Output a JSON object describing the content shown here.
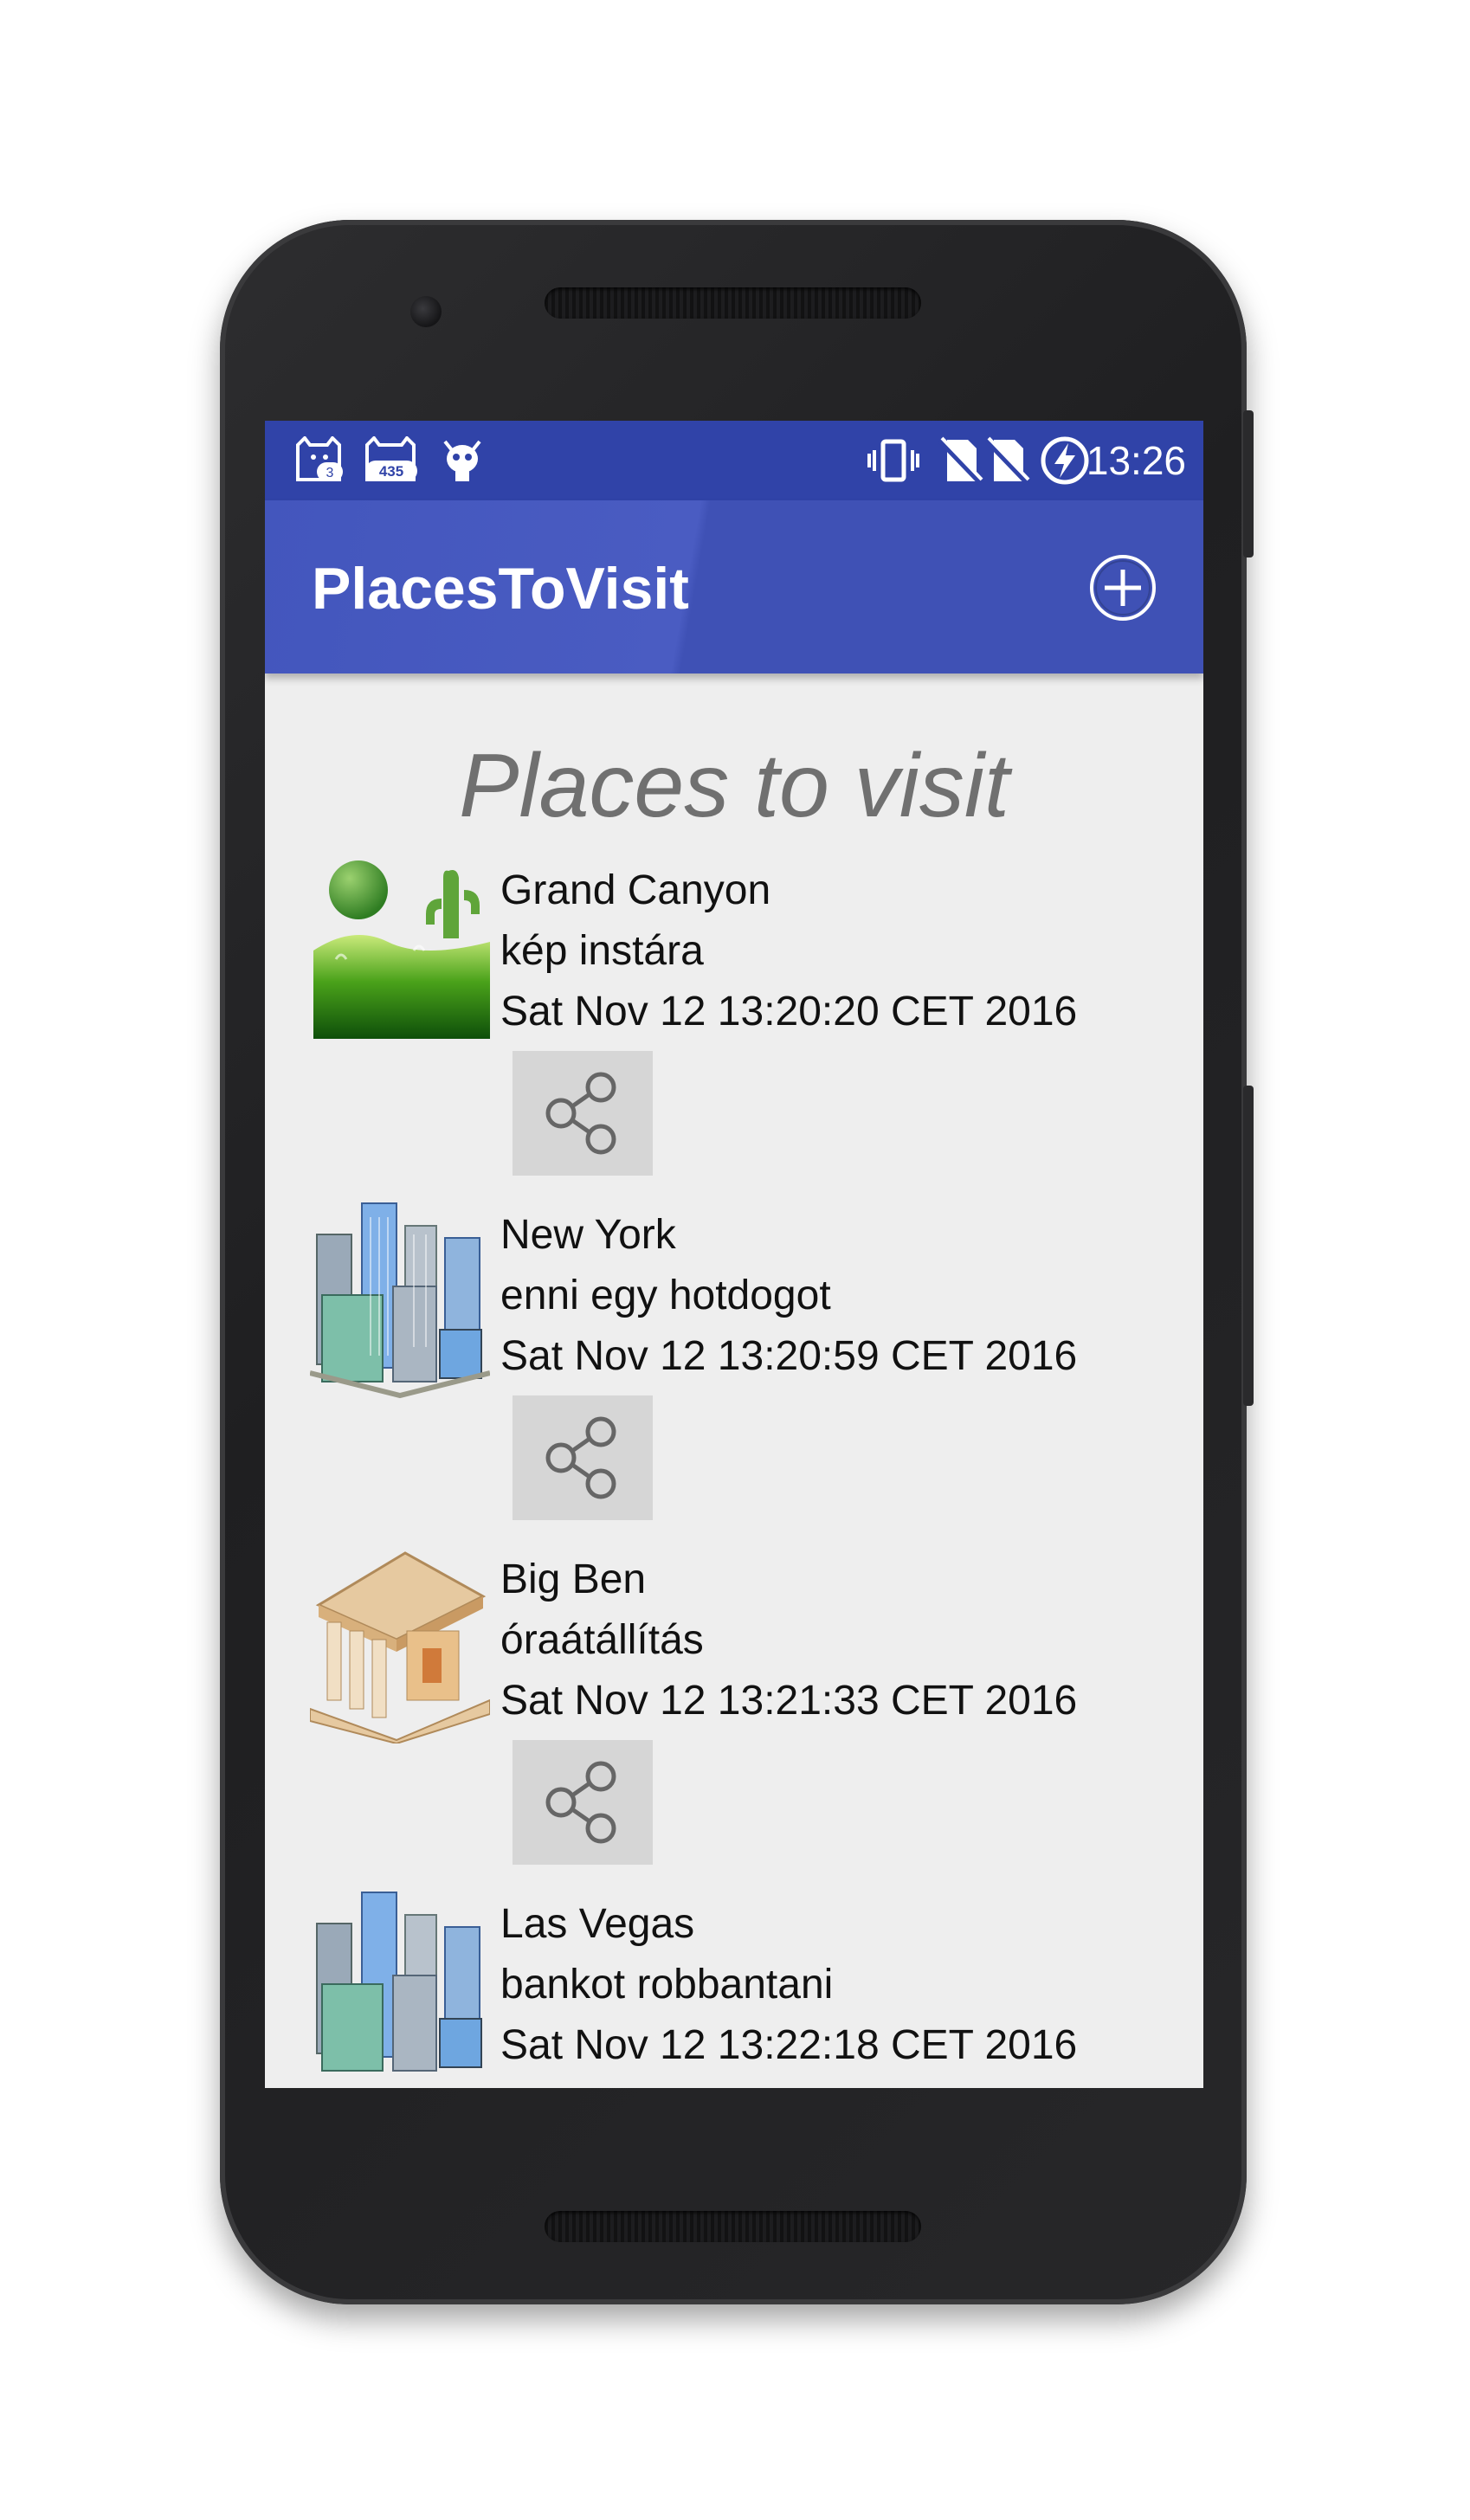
{
  "status_bar": {
    "time": "13:26",
    "badge_1": "3",
    "badge_2": "435",
    "icons": [
      "cat-badge-icon",
      "cat-badge-icon",
      "bug-icon",
      "vibrate-icon",
      "no-sim-icon",
      "no-sim-icon",
      "battery-charging-icon"
    ]
  },
  "app_bar": {
    "title": "PlacesToVisit",
    "add_icon": "add-circle-icon"
  },
  "main": {
    "heading": "Places to visit",
    "items": [
      {
        "name": "Grand Canyon",
        "description": "kép instára",
        "date": "Sat Nov 12 13:20:20 CET 2016",
        "icon": "desert-icon"
      },
      {
        "name": "New York",
        "description": "enni egy hotdogot",
        "date": "Sat Nov 12 13:20:59 CET 2016",
        "icon": "city-icon"
      },
      {
        "name": "Big Ben",
        "description": "óraátállítás",
        "date": "Sat Nov 12 13:21:33 CET 2016",
        "icon": "building-icon"
      },
      {
        "name": "Las Vegas",
        "description": "bankot robbantani",
        "date": "Sat Nov 12 13:22:18 CET 2016",
        "icon": "city-icon"
      }
    ]
  },
  "colors": {
    "status_bar": "#3043a8",
    "app_bar": "#3f51b5",
    "background": "#eeeeee"
  }
}
